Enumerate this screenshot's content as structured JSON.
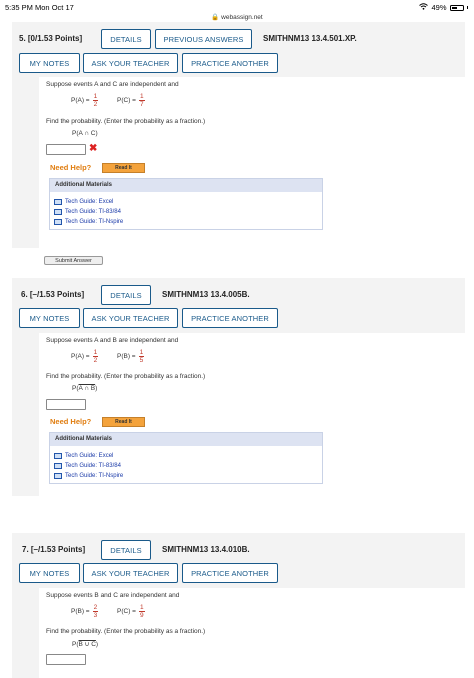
{
  "status": {
    "time": "5:35 PM   Mon Oct 17",
    "url": "webassign.net",
    "battery": "49%"
  },
  "questions": [
    {
      "number": "5. [0/1.53 Points]",
      "details": "DETAILS",
      "previous": "PREVIOUS ANSWERS",
      "id": "SMITHNM13 13.4.501.XP.",
      "my_notes": "MY NOTES",
      "ask_teacher": "ASK YOUR TEACHER",
      "practice": "PRACTICE ANOTHER",
      "intro": "Suppose events A and C are independent and",
      "p1_label": "P(A) =",
      "p1_num": "1",
      "p1_den": "2",
      "p2_label": "P(C) =",
      "p2_num": "1",
      "p2_den": "7",
      "find": "Find the probability. (Enter the probability as a fraction.)",
      "target": "P(A ∩ C)",
      "answer": "",
      "need_help": "Need Help?",
      "read_it": "Read It",
      "materials_title": "Additional Materials",
      "materials": [
        "Tech Guide: Excel",
        "Tech Guide: TI-83/84",
        "Tech Guide: TI-Nspire"
      ],
      "submit": "Submit Answer"
    },
    {
      "number": "6. [–/1.53 Points]",
      "details": "DETAILS",
      "id": "SMITHNM13 13.4.005B.",
      "my_notes": "MY NOTES",
      "ask_teacher": "ASK YOUR TEACHER",
      "practice": "PRACTICE ANOTHER",
      "intro": "Suppose events A and B are independent and",
      "p1_label": "P(A) =",
      "p1_num": "1",
      "p1_den": "2",
      "p2_label": "P(B) =",
      "p2_num": "1",
      "p2_den": "5",
      "find": "Find the probability. (Enter the probability as a fraction.)",
      "target_pre": "P(",
      "target_over": "A ∩ B",
      "target_post": ")",
      "answer": "",
      "need_help": "Need Help?",
      "read_it": "Read It",
      "materials_title": "Additional Materials",
      "materials": [
        "Tech Guide: Excel",
        "Tech Guide: TI-83/84",
        "Tech Guide: TI-Nspire"
      ]
    },
    {
      "number": "7. [–/1.53 Points]",
      "details": "DETAILS",
      "id": "SMITHNM13 13.4.010B.",
      "my_notes": "MY NOTES",
      "ask_teacher": "ASK YOUR TEACHER",
      "practice": "PRACTICE ANOTHER",
      "intro": "Suppose events B and C are independent and",
      "p1_label": "P(B) =",
      "p1_num": "2",
      "p1_den": "3",
      "p2_label": "P(C) =",
      "p2_num": "1",
      "p2_den": "9",
      "find": "Find the probability. (Enter the probability as a fraction.)",
      "target_pre": "P(",
      "target_over": "B ∪ C",
      "target_post": ")",
      "answer": ""
    }
  ]
}
